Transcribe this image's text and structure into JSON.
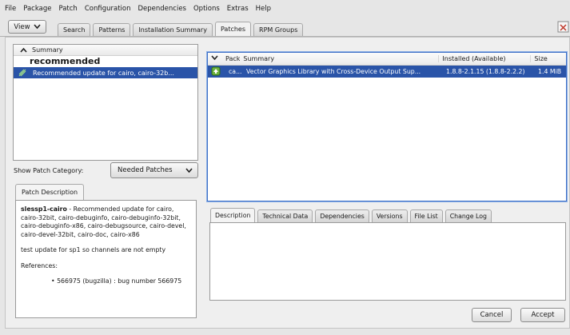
{
  "menu": {
    "file": "File",
    "package": "Package",
    "patch": "Patch",
    "configuration": "Configuration",
    "dependencies": "Dependencies",
    "options": "Options",
    "extras": "Extras",
    "help": "Help"
  },
  "toolbar": {
    "view_label": "View",
    "tabs": [
      "Search",
      "Patterns",
      "Installation Summary",
      "Patches",
      "RPM Groups"
    ]
  },
  "summary_list": {
    "header": "Summary",
    "group_title": "recommended",
    "selected_item": "Recommended update for cairo, cairo-32b..."
  },
  "patch_category": {
    "label": "Show Patch Category:",
    "value": "Needed Patches"
  },
  "patch_description": {
    "tab": "Patch Description",
    "name": "slessp1-cairo",
    "summary": " - Recommended update for cairo, cairo-32bit, cairo-debuginfo, cairo-debuginfo-32bit, cairo-debuginfo-x86, cairo-debugsource, cairo-devel, cairo-devel-32bit, cairo-doc, cairo-x86",
    "note": "test update for sp1 so channels are not empty",
    "references_label": "References:",
    "reference": "566975 (bugzilla) : bug number 566975"
  },
  "package_table": {
    "columns": {
      "pack": "Pack",
      "summary": "Summary",
      "installed": "Installed (Available)",
      "size": "Size"
    },
    "row": {
      "name": "ca...",
      "summary": "Vector Graphics Library with Cross-Device Output Sup...",
      "installed": "1.8.8-2.1.15 (1.8.8-2.2.2)",
      "size": "1.4 MiB"
    }
  },
  "details_tabs": [
    "Description",
    "Technical Data",
    "Dependencies",
    "Versions",
    "File List",
    "Change Log"
  ],
  "buttons": {
    "cancel": "Cancel",
    "accept": "Accept"
  },
  "colors": {
    "selection": "#2a54a8",
    "focus_border": "#3d6fc6"
  }
}
